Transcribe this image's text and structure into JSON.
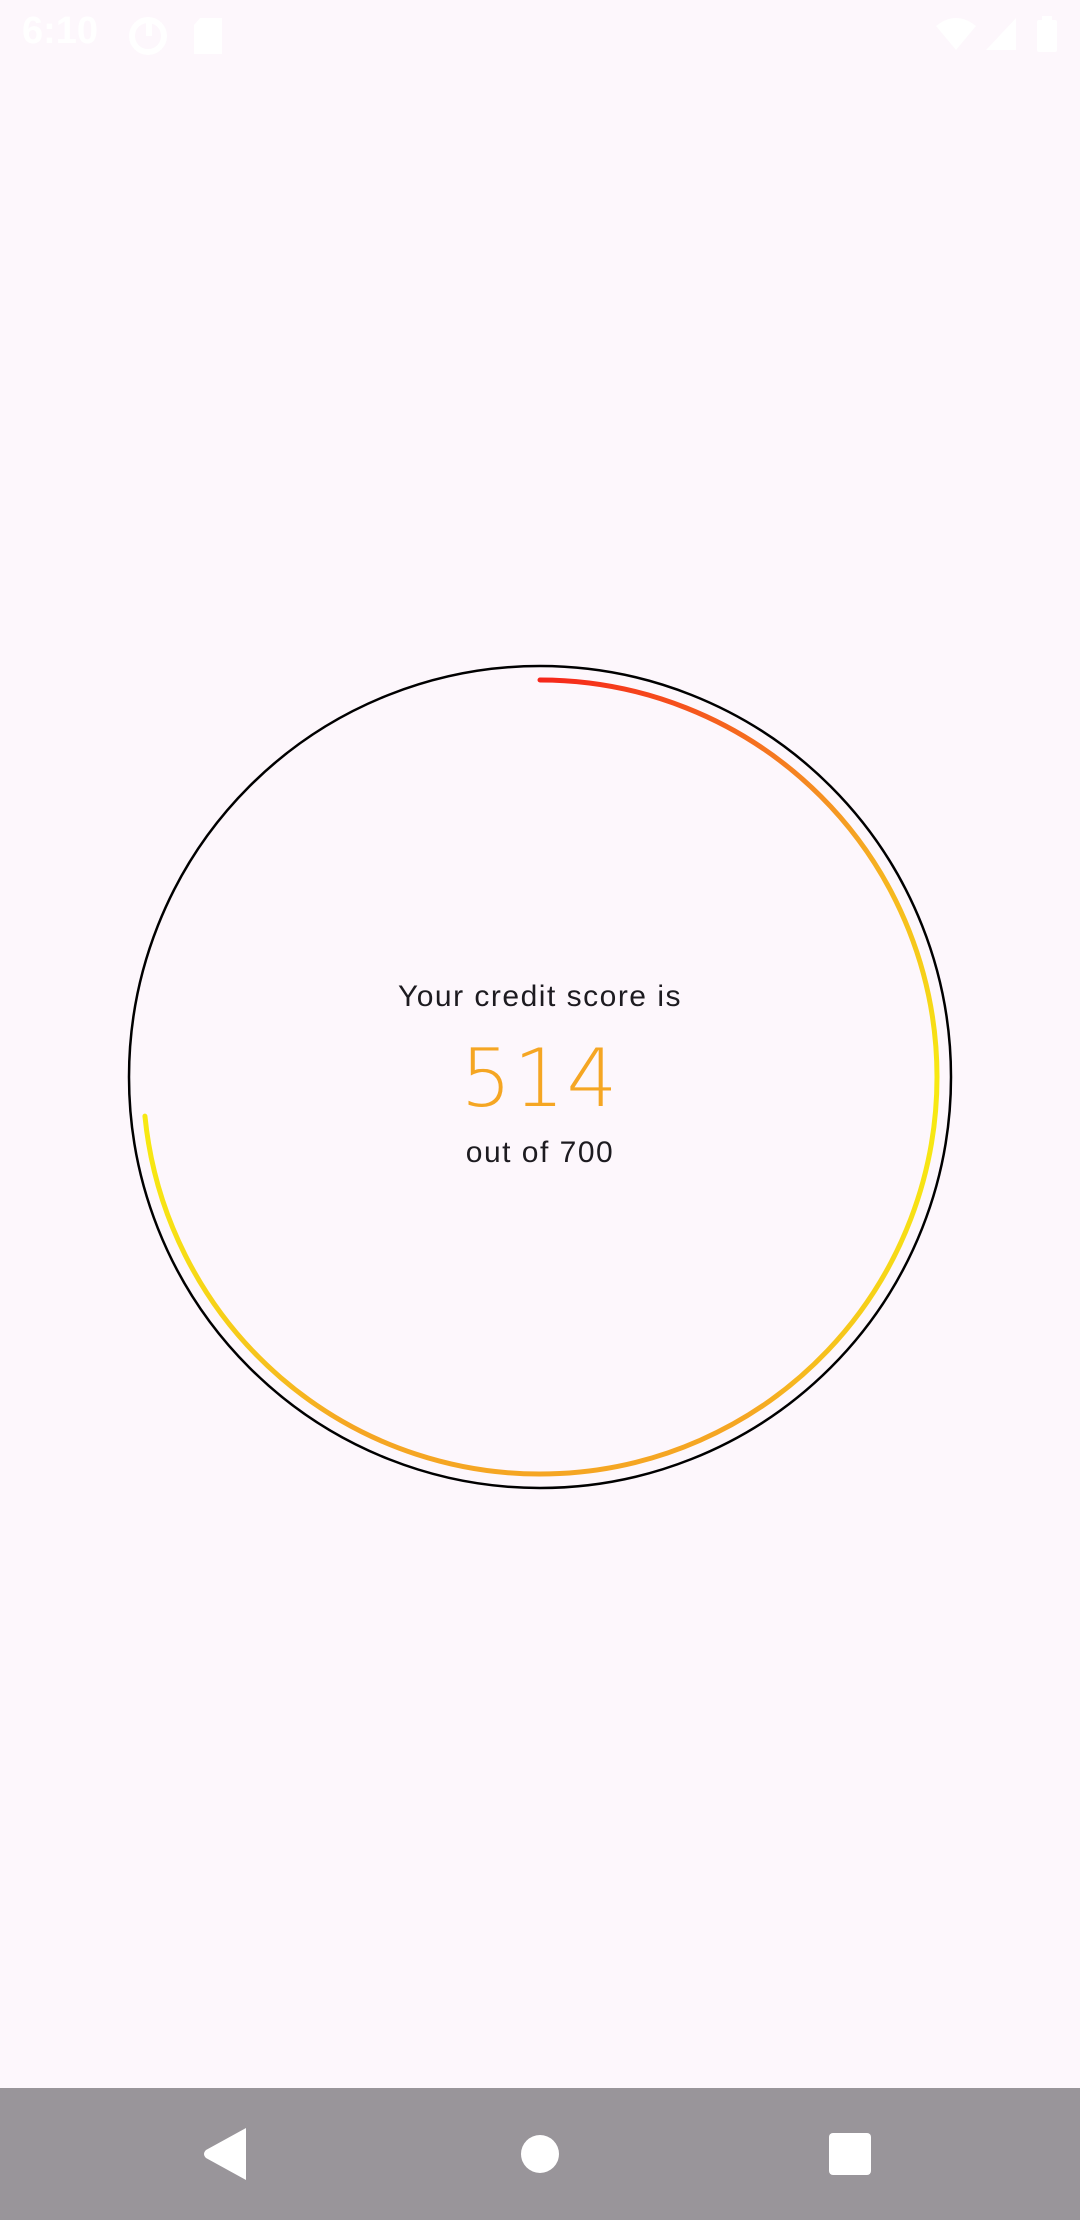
{
  "status_bar": {
    "time": "6:10",
    "icons": [
      "data-saver-icon",
      "sd-card-icon",
      "wifi-icon",
      "cell-signal-icon",
      "battery-icon"
    ]
  },
  "score_card": {
    "heading": "Your credit score is",
    "score": "514",
    "max_label": "out of 700",
    "score_value": 514,
    "max_value": 700,
    "colors": {
      "score_text": "#f5a623",
      "ring_outline": "#000000",
      "gradient_start": "#f5261a",
      "gradient_mid": "#f5a623",
      "gradient_end": "#f7ea12"
    }
  },
  "nav_bar": {
    "buttons": [
      "back-icon",
      "home-icon",
      "recents-icon"
    ]
  }
}
